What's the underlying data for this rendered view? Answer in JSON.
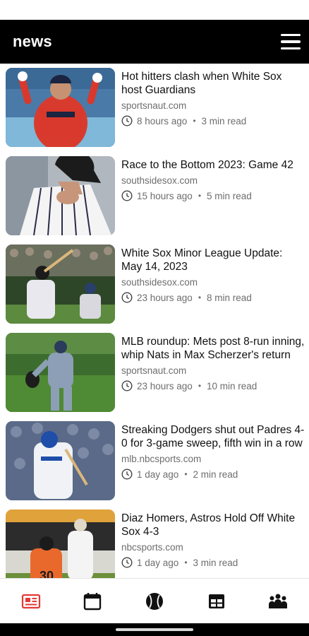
{
  "app": {
    "title": "news"
  },
  "articles": [
    {
      "headline": "Hot hitters clash when White Sox host Guardians",
      "source": "sportsnaut.com",
      "time": "8 hours ago",
      "read": "3 min read"
    },
    {
      "headline": "Race to the Bottom 2023: Game 42",
      "source": "southsidesox.com",
      "time": "15 hours ago",
      "read": "5 min read"
    },
    {
      "headline": "White Sox Minor League Update: May 14, 2023",
      "source": "southsidesox.com",
      "time": "23 hours ago",
      "read": "8 min read"
    },
    {
      "headline": "MLB roundup: Mets post 8-run inning, whip Nats in Max Scherzer's return",
      "source": "sportsnaut.com",
      "time": "23 hours ago",
      "read": "10 min read"
    },
    {
      "headline": "Streaking Dodgers shut out Padres 4-0 for 3-game sweep, fifth win in a row",
      "source": "mlb.nbcsports.com",
      "time": "1 day ago",
      "read": "2 min read"
    },
    {
      "headline": "Diaz Homers, Astros Hold Off White Sox 4-3",
      "source": "nbcsports.com",
      "time": "1 day ago",
      "read": "3 min read"
    }
  ],
  "bottom_nav": {
    "items": [
      "news-icon",
      "calendar-icon",
      "baseball-icon",
      "table-icon",
      "team-icon"
    ],
    "active": "news-icon",
    "active_color": "#e53935",
    "inactive_color": "#111111"
  }
}
